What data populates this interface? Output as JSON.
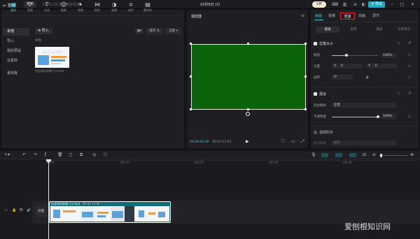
{
  "app": {
    "name": "剪映",
    "menu_label": "菜单",
    "autosave": "13:31:33 自动保存本地",
    "project_title": "10月5日 (2)",
    "pro_badge": "VIP",
    "export_label": "导出"
  },
  "toolbar": {
    "tabs": [
      {
        "icon": "media-icon",
        "glyph": "▣",
        "label": "媒体"
      },
      {
        "icon": "audio-icon",
        "glyph": "♪",
        "label": "音频"
      },
      {
        "icon": "text-icon",
        "glyph": "T",
        "label": "文本"
      },
      {
        "icon": "sticker-icon",
        "glyph": "☺",
        "label": "贴纸"
      },
      {
        "icon": "effects-icon",
        "glyph": "✦",
        "label": "特效"
      },
      {
        "icon": "transition-icon",
        "glyph": "⋈",
        "label": "转场"
      },
      {
        "icon": "filter-icon",
        "glyph": "◑",
        "label": "滤镜"
      },
      {
        "icon": "adjust-icon",
        "glyph": "≑",
        "label": "调节"
      },
      {
        "icon": "template-icon",
        "glyph": "▤",
        "label": "素材包"
      }
    ]
  },
  "sidebar": {
    "items": [
      "本地",
      "导入",
      "我的预设",
      "云素材",
      "素材库"
    ]
  },
  "media": {
    "import_label": "导入",
    "sort_label": "排序",
    "all_label": "全部",
    "section": "本地",
    "file_caption": "包含如何剪辑 (1).mp4"
  },
  "player": {
    "title": "播放器",
    "time_current": "00:00:00:00",
    "time_total": "00:03:13:01"
  },
  "inspector": {
    "tabs": [
      "画面",
      "音频",
      "变速",
      "动画",
      "调节"
    ],
    "subtabs": [
      "基础",
      "抠像",
      "蒙版",
      "背景填充"
    ],
    "position_size": {
      "title": "位置大小",
      "scale_label": "缩放",
      "scale_value": "100%",
      "pos_label": "位置",
      "x_label": "X",
      "x_value": "0",
      "y_label": "Y",
      "y_value": "0",
      "rotate_label": "旋转",
      "rotate_value": "0°",
      "scale_fraction": 0.32
    },
    "blend": {
      "title": "混合",
      "mode_label": "混合模式",
      "mode_value": "正常",
      "opacity_label": "不透明度",
      "opacity_value": "100%",
      "opacity_fraction": 1.0
    },
    "stabilize": {
      "title": "视频防抖",
      "level_label": "防抖等级",
      "level_value": "推荐"
    }
  },
  "timeline": {
    "ruler": [
      "00:00",
      "|00:10",
      "|00:20",
      "|00:30",
      "|00:40"
    ],
    "cover_label": "封面",
    "clip_name": "包含如何剪辑 (1).mp4",
    "clip_duration": "00:03:13:00"
  },
  "watermark": "爱刨根知识网"
}
